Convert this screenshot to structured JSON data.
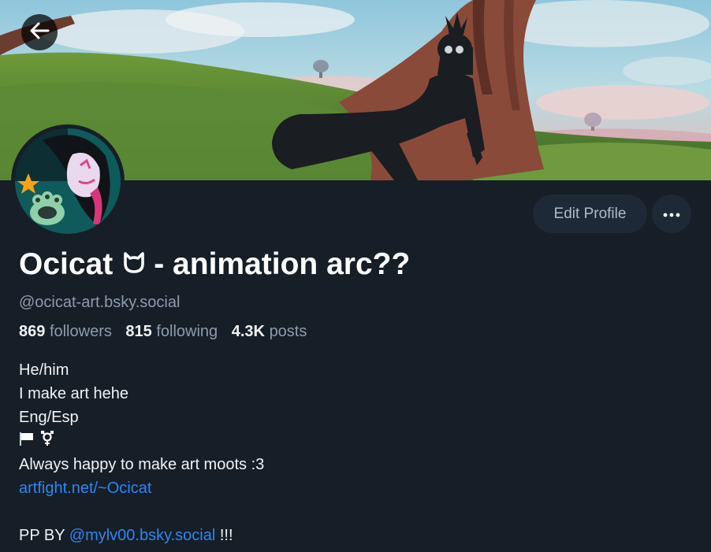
{
  "profile": {
    "display_name_part1": "Ocicat",
    "display_name_part2": "- animation arc??",
    "handle": "@ocicat-art.bsky.social",
    "stats": {
      "followers_count": "869",
      "followers_label": "followers",
      "following_count": "815",
      "following_label": "following",
      "posts_count": "4.3K",
      "posts_label": "posts"
    },
    "bio": {
      "line1": "He/him",
      "line2": "I make art hehe",
      "line3": "Eng/Esp",
      "line5": "Always happy to make art moots :3",
      "link": "artfight.net/~Ocicat",
      "pp_prefix": "PP BY",
      "pp_mention": "@mylv00.bsky.social",
      "pp_suffix": "!!!"
    }
  },
  "actions": {
    "edit_profile_label": "Edit Profile"
  },
  "icons": {
    "back": "arrow-left-icon",
    "more": "ellipsis-icon",
    "cat": "cat-face-icon",
    "flag": "white-flag-icon",
    "transgender": "transgender-symbol-icon"
  },
  "colors": {
    "background": "#161e27",
    "button_bg": "#1e2937",
    "muted_text": "#8d9cad",
    "link": "#2f86f1"
  }
}
